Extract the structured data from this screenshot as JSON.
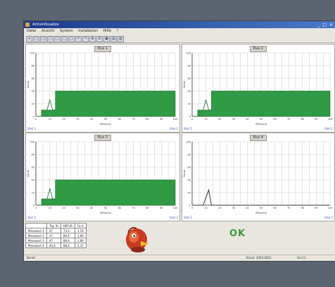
{
  "window": {
    "title": "ActiveVisualize",
    "controls": "_ □ ×"
  },
  "menu": [
    "Datei",
    "Ansicht",
    "System",
    "Installation",
    "Hilfe",
    "?"
  ],
  "toolbar": [
    "+",
    "▢",
    "▢",
    "▢",
    "▢",
    "▢",
    "▢",
    "↶",
    "↷",
    "⊕",
    "⊖",
    "▣",
    "▤",
    "▥"
  ],
  "panels": [
    {
      "title": "Bus 1",
      "y_label": "Kanal",
      "x_label": "Messung",
      "left_note": "Stat 1",
      "right_note": "Stat 2"
    },
    {
      "title": "Bus 2",
      "y_label": "Kanal",
      "x_label": "Messung",
      "left_note": "Stat 1",
      "right_note": "Stat 2"
    },
    {
      "title": "Bus 3",
      "y_label": "Kanal",
      "x_label": "Messung",
      "left_note": "Stat 1",
      "right_note": "Stat 2"
    },
    {
      "title": "Bus 4",
      "y_label": "Kanal",
      "x_label": "Messung",
      "left_note": "Stat 1",
      "right_note": "Stat 2"
    }
  ],
  "chart_data": [
    {
      "type": "area",
      "title": "Bus 1",
      "x": [
        0,
        4,
        4,
        14,
        14,
        100
      ],
      "y": [
        0,
        0,
        10,
        10,
        40,
        40
      ],
      "peak": {
        "x": [
          8,
          10,
          12,
          14
        ],
        "y": [
          10,
          26,
          10,
          10
        ]
      },
      "ylim": [
        0,
        100
      ],
      "xlim": [
        0,
        100
      ],
      "grid": true
    },
    {
      "type": "area",
      "title": "Bus 2",
      "x": [
        0,
        4,
        4,
        14,
        14,
        100
      ],
      "y": [
        0,
        0,
        10,
        10,
        40,
        40
      ],
      "peak": {
        "x": [
          8,
          10,
          12,
          14
        ],
        "y": [
          10,
          26,
          10,
          10
        ]
      },
      "ylim": [
        0,
        100
      ],
      "xlim": [
        0,
        100
      ],
      "grid": true
    },
    {
      "type": "area",
      "title": "Bus 3",
      "x": [
        0,
        4,
        4,
        14,
        14,
        100
      ],
      "y": [
        0,
        0,
        10,
        10,
        40,
        40
      ],
      "peak": {
        "x": [
          8,
          10,
          12,
          14
        ],
        "y": [
          10,
          26,
          10,
          10
        ]
      },
      "ylim": [
        0,
        100
      ],
      "xlim": [
        0,
        100
      ],
      "grid": true
    },
    {
      "type": "line",
      "title": "Bus 4",
      "x": [
        0,
        8,
        10,
        12,
        14,
        100
      ],
      "y": [
        0,
        0,
        12,
        24,
        0,
        0
      ],
      "ylim": [
        0,
        100
      ],
      "xlim": [
        0,
        100
      ],
      "grid": true
    }
  ],
  "stats": {
    "headers": [
      "",
      "Ttg. IR",
      "HRT-IR",
      "Fa-U"
    ],
    "rows": [
      [
        "Messwert 1",
        "47",
        "73,4",
        "1,54"
      ],
      [
        "Messwert 2",
        "47",
        "89,4",
        "1,89"
      ],
      [
        "Messwert 3",
        "47",
        "89,4",
        "1,89"
      ],
      [
        "Messwert 4",
        "44,4",
        "88,4",
        "1,37"
      ]
    ]
  },
  "result": {
    "ok_label": "OK"
  },
  "status": {
    "left": "Bereit",
    "mid": "Kanal: 1004-0001",
    "right": "Ver.12"
  },
  "colors": {
    "fill": "#2f9b45",
    "grid": "#c8c8c8",
    "accent": "#3a9a3a"
  }
}
